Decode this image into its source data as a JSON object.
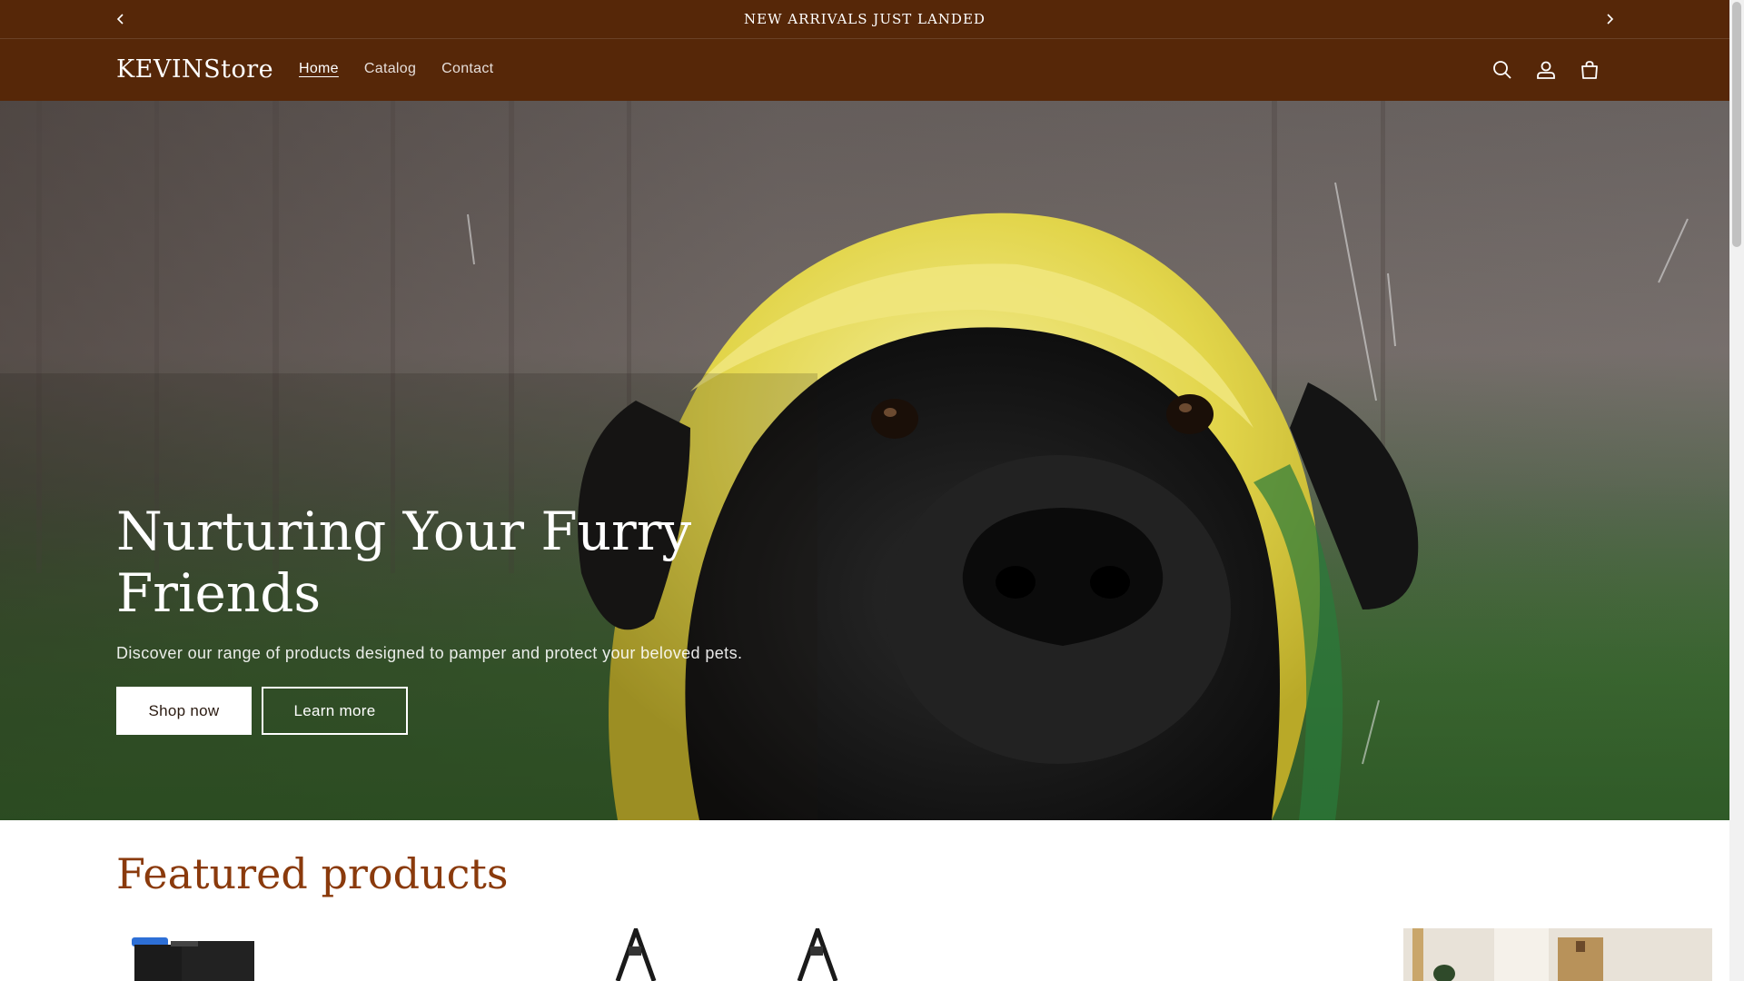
{
  "announcement": {
    "text": "NEW ARRIVALS JUST LANDED",
    "prev_icon": "chevron-left-icon",
    "next_icon": "chevron-right-icon"
  },
  "header": {
    "logo": "KEVINStore",
    "nav": [
      {
        "label": "Home",
        "active": true
      },
      {
        "label": "Catalog",
        "active": false
      },
      {
        "label": "Contact",
        "active": false
      }
    ],
    "icons": [
      "search-icon",
      "account-icon",
      "cart-icon"
    ]
  },
  "hero": {
    "title": "Nurturing Your Furry Friends",
    "subtitle": "Discover our range of products designed to pamper and protect your beloved pets.",
    "primary_button": "Shop now",
    "secondary_button": "Learn more"
  },
  "featured": {
    "title": "Featured products"
  },
  "colors": {
    "header_bg": "#562708",
    "accent": "#8a3a0c",
    "raincoat": "#e6d84a"
  }
}
